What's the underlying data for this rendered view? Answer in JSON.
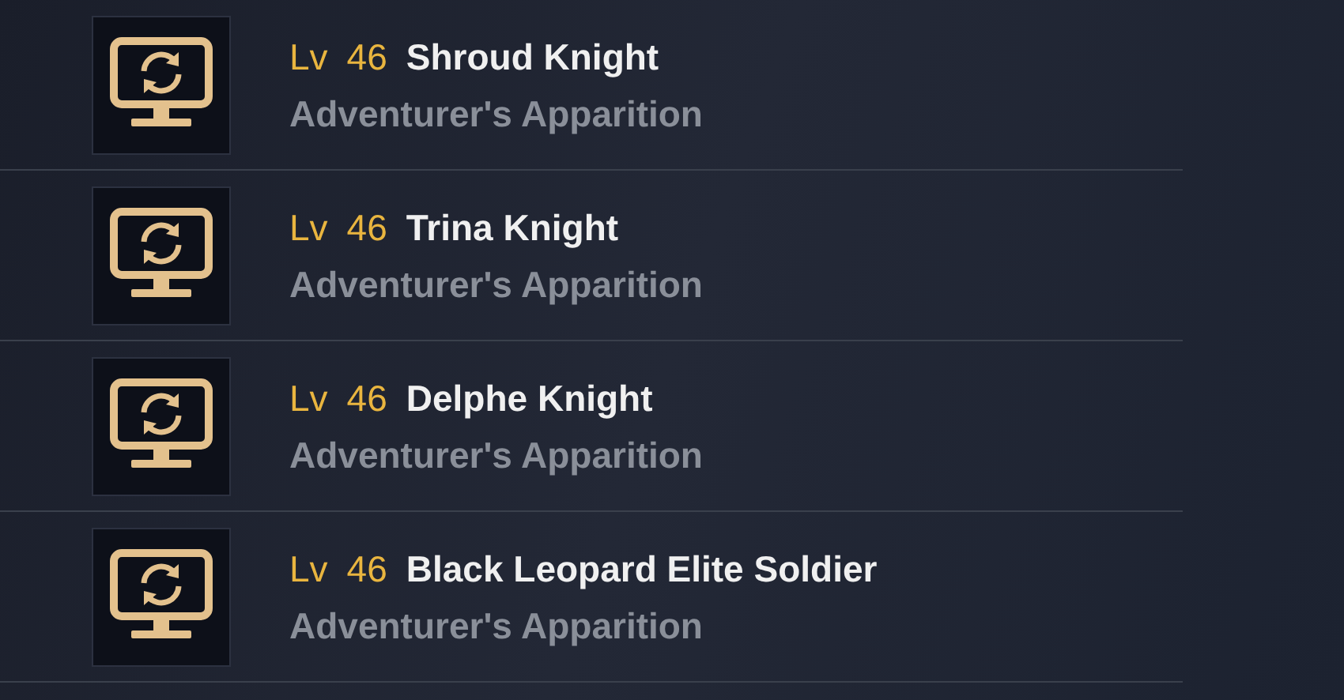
{
  "entries": [
    {
      "level_label": "Lv",
      "level": "46",
      "name": "Shroud Knight",
      "subtitle": "Adventurer's Apparition"
    },
    {
      "level_label": "Lv",
      "level": "46",
      "name": "Trina Knight",
      "subtitle": "Adventurer's Apparition"
    },
    {
      "level_label": "Lv",
      "level": "46",
      "name": "Delphe Knight",
      "subtitle": "Adventurer's Apparition"
    },
    {
      "level_label": "Lv",
      "level": "46",
      "name": "Black Leopard Elite Soldier",
      "subtitle": "Adventurer's Apparition"
    }
  ]
}
